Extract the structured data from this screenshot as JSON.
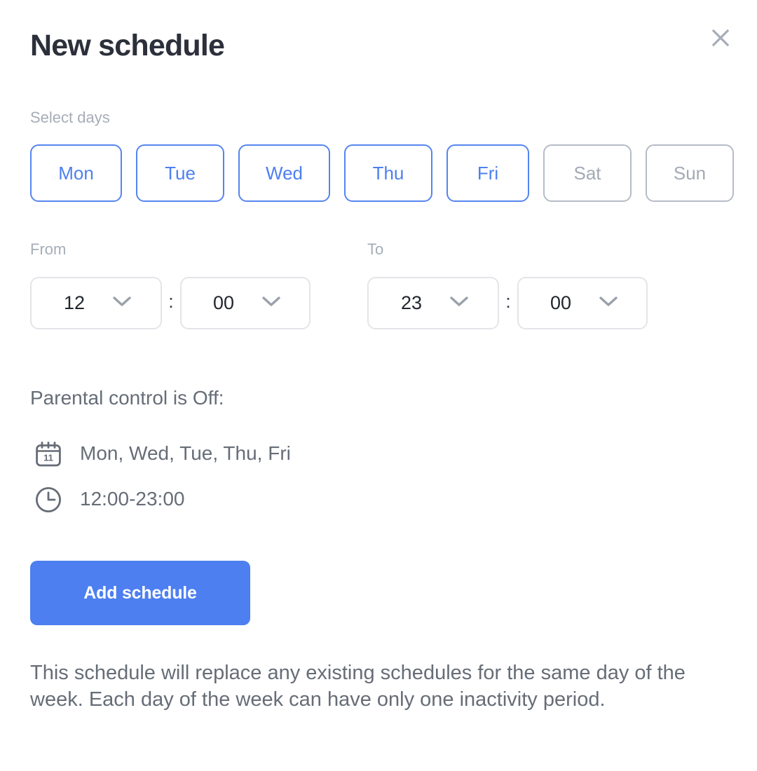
{
  "dialog": {
    "title": "New schedule",
    "close_icon": "close-x-icon"
  },
  "select_days": {
    "label": "Select days",
    "days": [
      {
        "label": "Mon",
        "selected": true
      },
      {
        "label": "Tue",
        "selected": true
      },
      {
        "label": "Wed",
        "selected": true
      },
      {
        "label": "Thu",
        "selected": true
      },
      {
        "label": "Fri",
        "selected": true
      },
      {
        "label": "Sat",
        "selected": false
      },
      {
        "label": "Sun",
        "selected": false
      }
    ]
  },
  "time_range": {
    "from_label": "From",
    "to_label": "To",
    "separator": ":",
    "from_hour": "12",
    "from_minute": "00",
    "to_hour": "23",
    "to_minute": "00",
    "chevron_icon": "chevron-down-icon"
  },
  "summary": {
    "title": "Parental control is Off:",
    "days_icon": "calendar-icon",
    "days_value": "Mon, Wed, Tue, Thu, Fri",
    "hours_icon": "clock-icon",
    "hours_value": "12:00-23:00"
  },
  "actions": {
    "submit_label": "Add schedule"
  },
  "note": {
    "text": "This schedule will replace any existing schedules for the same day of the week. Each day of the week can have only one inactivity period."
  },
  "colors": {
    "accent": "#4d7ff0",
    "title": "#2b303b",
    "muted": "#a6adb8",
    "body": "#666d77",
    "border": "#e3e5e9",
    "border_unselected": "#b6bcc6"
  }
}
